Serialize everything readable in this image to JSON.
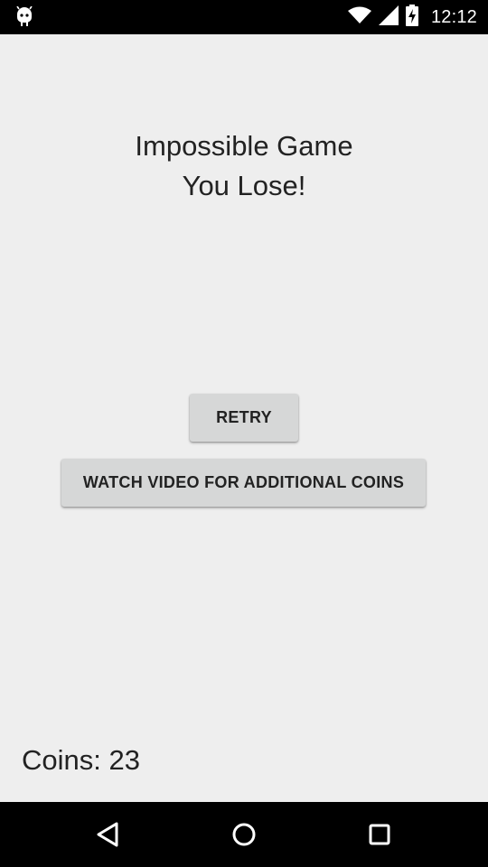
{
  "status_bar": {
    "time": "12:12",
    "left_icon": "android-debug-icon",
    "icons": [
      "wifi-icon",
      "signal-icon",
      "battery-charging-icon"
    ]
  },
  "game": {
    "title_line1": "Impossible Game",
    "title_line2": "You Lose!",
    "retry_label": "RETRY",
    "watch_video_label": "WATCH VIDEO FOR ADDITIONAL COINS",
    "coins_text": "Coins: 23"
  },
  "nav_bar": {
    "buttons": [
      "back-icon",
      "home-icon",
      "recent-apps-icon"
    ]
  },
  "colors": {
    "background": "#eeeeee",
    "button": "#d6d7d7",
    "text": "#222222",
    "bars": "#000000"
  }
}
